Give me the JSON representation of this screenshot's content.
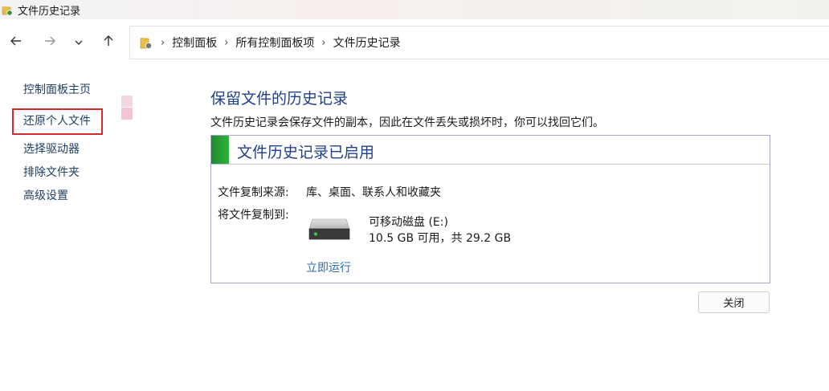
{
  "window": {
    "title": "文件历史记录"
  },
  "nav": {
    "back_icon": "arrow-left-icon",
    "forward_icon": "arrow-right-icon",
    "recent_icon": "chevron-down-icon",
    "up_icon": "arrow-up-icon",
    "breadcrumb": [
      "控制面板",
      "所有控制面板项",
      "文件历史记录"
    ]
  },
  "sidebar": {
    "home": "控制面板主页",
    "items": [
      "还原个人文件",
      "选择驱动器",
      "排除文件夹",
      "高级设置"
    ]
  },
  "main": {
    "title": "保留文件的历史记录",
    "description": "文件历史记录会保存文件的副本，因此在文件丢失或损坏时，你可以找回它们。",
    "panel": {
      "status_title": "文件历史记录已启用",
      "status_color": "#2fb33d",
      "source_label": "文件复制来源:",
      "source_value": "库、桌面、联系人和收藏夹",
      "target_label": "将文件复制到:",
      "drive_name": "可移动磁盘 (E:)",
      "drive_space": "10.5 GB 可用，共 29.2 GB",
      "run_now": "立即运行"
    },
    "close_button": "关闭"
  },
  "colors": {
    "highlight_box": "#d8282e",
    "title_blue": "#1f3f8f",
    "link_blue": "#2a6db5"
  }
}
